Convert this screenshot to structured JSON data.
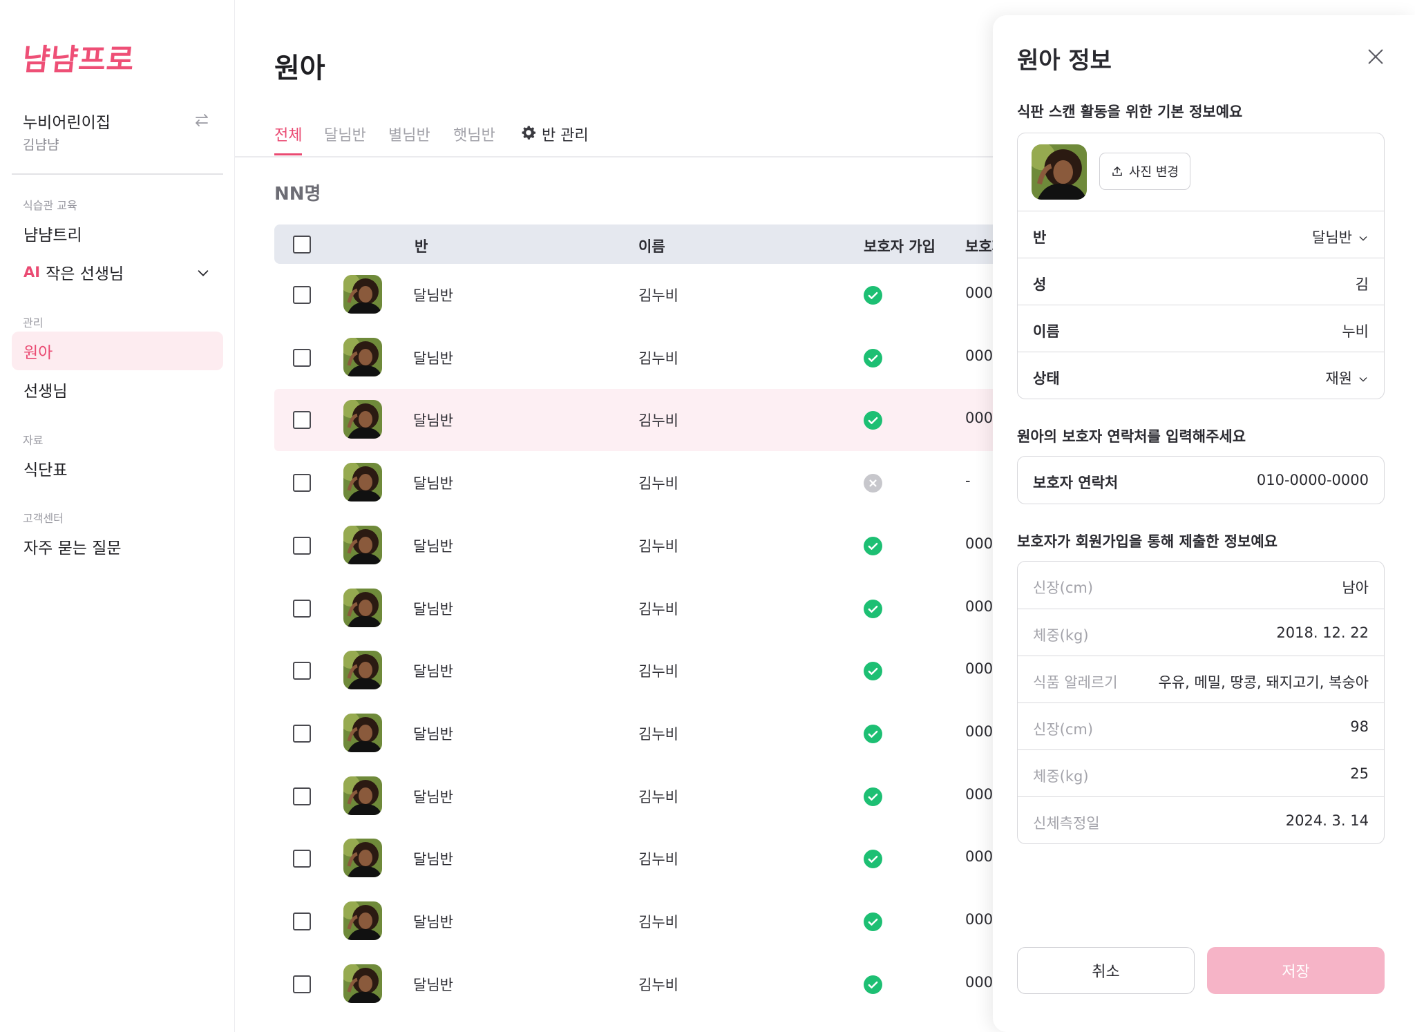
{
  "sidebar": {
    "logo": "냠냠프로",
    "org_name": "누비어린이집",
    "user_name": "김냠냠",
    "section_habit": "식습관 교육",
    "item_nyamtree": "냠냠트리",
    "ai_badge": "AI",
    "item_ai_teacher": "작은 선생님",
    "section_manage": "관리",
    "item_children": "원아",
    "item_teachers": "선생님",
    "section_data": "자료",
    "item_menu": "식단표",
    "section_support": "고객센터",
    "item_faq": "자주 묻는 질문"
  },
  "main": {
    "title": "원아",
    "tabs": [
      "전체",
      "달님반",
      "별님반",
      "햇님반"
    ],
    "class_manage": "반 관리",
    "count": "NN명",
    "columns": {
      "class": "반",
      "name": "이름",
      "guardian_joined": "보호자 가입",
      "guardian_contact": "보호자"
    },
    "rows": [
      {
        "class": "달님반",
        "name": "김누비",
        "joined": true,
        "contact": "000"
      },
      {
        "class": "달님반",
        "name": "김누비",
        "joined": true,
        "contact": "000"
      },
      {
        "class": "달님반",
        "name": "김누비",
        "joined": true,
        "contact": "000"
      },
      {
        "class": "달님반",
        "name": "김누비",
        "joined": false,
        "contact": "-"
      },
      {
        "class": "달님반",
        "name": "김누비",
        "joined": true,
        "contact": "000"
      },
      {
        "class": "달님반",
        "name": "김누비",
        "joined": true,
        "contact": "000"
      },
      {
        "class": "달님반",
        "name": "김누비",
        "joined": true,
        "contact": "000"
      },
      {
        "class": "달님반",
        "name": "김누비",
        "joined": true,
        "contact": "000"
      },
      {
        "class": "달님반",
        "name": "김누비",
        "joined": true,
        "contact": "000"
      },
      {
        "class": "달님반",
        "name": "김누비",
        "joined": true,
        "contact": "000"
      },
      {
        "class": "달님반",
        "name": "김누비",
        "joined": true,
        "contact": "000"
      },
      {
        "class": "달님반",
        "name": "김누비",
        "joined": true,
        "contact": "000"
      }
    ]
  },
  "panel": {
    "title": "원아 정보",
    "basic_info_desc": "식판 스캔 활동을 위한 기본 정보예요",
    "photo_button": "사진 변경",
    "fields": [
      {
        "label": "반",
        "value": "달님반",
        "dropdown": true
      },
      {
        "label": "성",
        "value": "김",
        "dropdown": false
      },
      {
        "label": "이름",
        "value": "누비",
        "dropdown": false
      },
      {
        "label": "상태",
        "value": "재원",
        "dropdown": true
      }
    ],
    "contact_desc": "원아의 보호자 연락처를 입력해주세요",
    "contact_label": "보호자 연락처",
    "contact_value": "010-0000-0000",
    "submitted_desc": "보호자가 회원가입을 통해 제출한 정보예요",
    "submitted": [
      {
        "label": "신장(cm)",
        "value": "남아"
      },
      {
        "label": "체중(kg)",
        "value": "2018. 12. 22"
      },
      {
        "label": "식품 알레르기",
        "value": "우유, 메밀, 땅콩, 돼지고기, 복숭아"
      },
      {
        "label": "신장(cm)",
        "value": "98"
      },
      {
        "label": "체중(kg)",
        "value": "25"
      },
      {
        "label": "신체측정일",
        "value": "2024. 3. 14"
      }
    ],
    "cancel_label": "취소",
    "save_label": "저장"
  },
  "colors": {
    "accent": "#ea4a72",
    "active_bg": "#fdecf0",
    "success": "#1dbf73",
    "save_disabled": "#f6b4c7"
  }
}
